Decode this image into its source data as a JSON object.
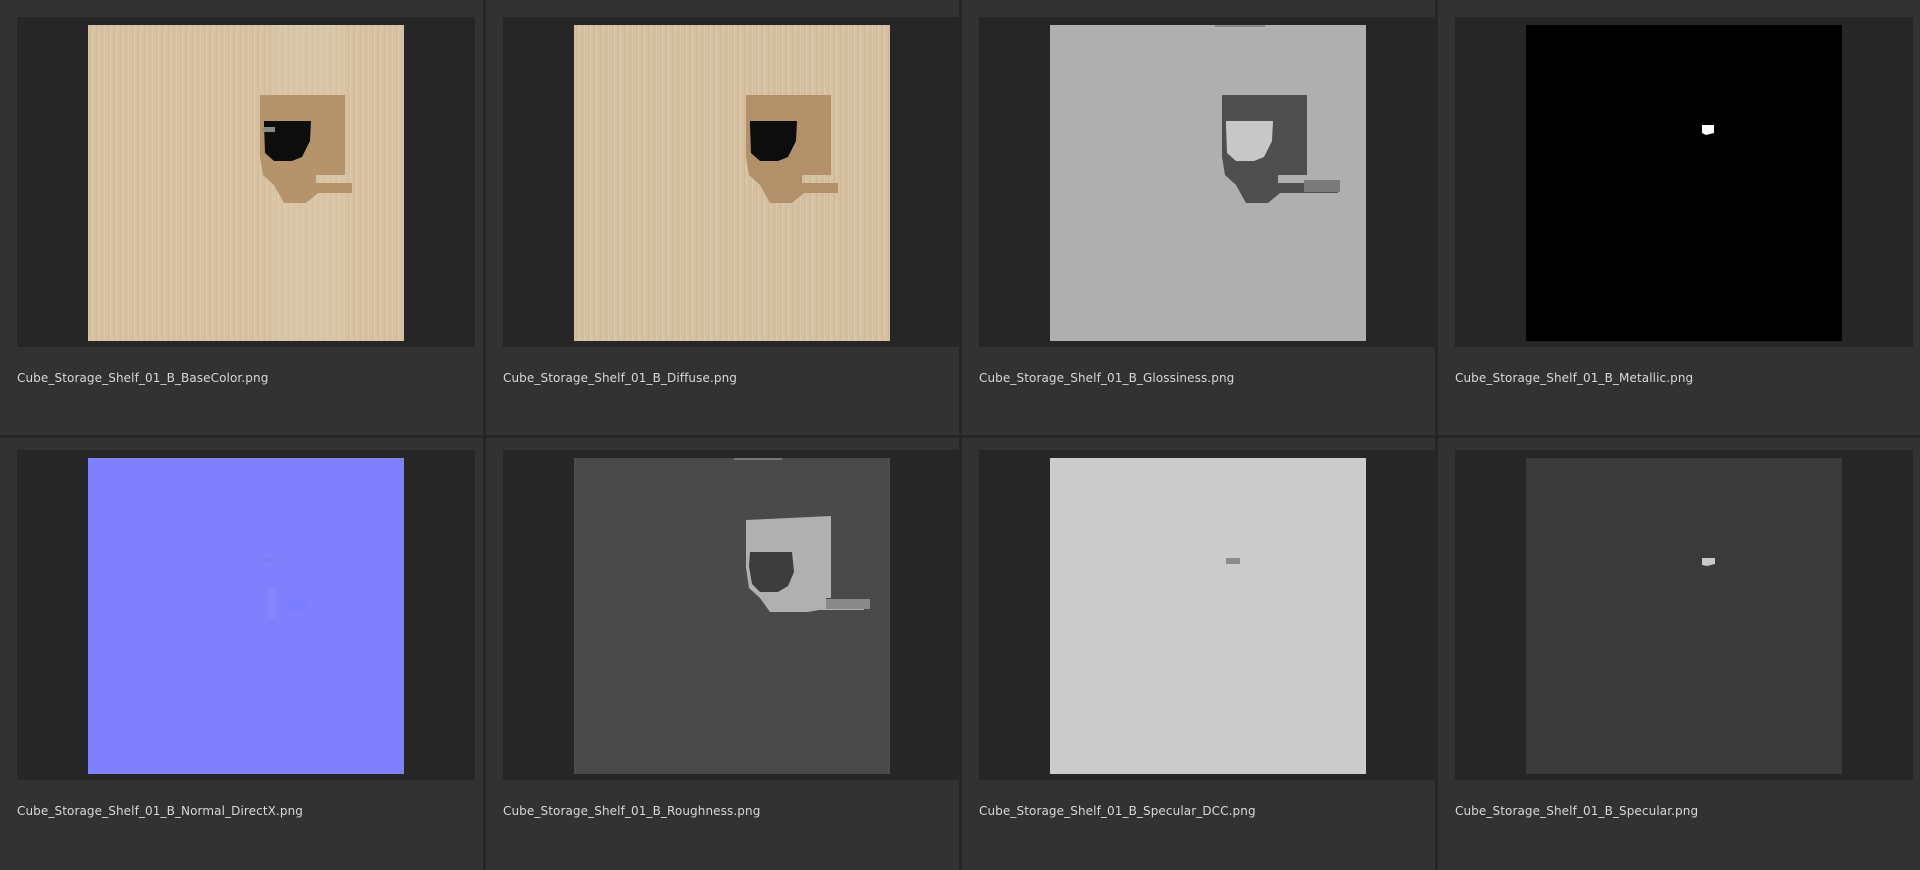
{
  "assets": [
    {
      "filename": "Cube_Storage_Shelf_01_B_BaseColor.png",
      "map": "basecolor",
      "icon": "wood-texture-thumbnail"
    },
    {
      "filename": "Cube_Storage_Shelf_01_B_Diffuse.png",
      "map": "diffuse",
      "icon": "wood-texture-thumbnail"
    },
    {
      "filename": "Cube_Storage_Shelf_01_B_Glossiness.png",
      "map": "glossiness",
      "icon": "grayscale-texture-thumbnail"
    },
    {
      "filename": "Cube_Storage_Shelf_01_B_Metallic.png",
      "map": "metallic",
      "icon": "black-texture-thumbnail"
    },
    {
      "filename": "Cube_Storage_Shelf_01_B_Normal_DirectX.png",
      "map": "normal",
      "icon": "normal-map-thumbnail"
    },
    {
      "filename": "Cube_Storage_Shelf_01_B_Roughness.png",
      "map": "roughness",
      "icon": "grayscale-texture-thumbnail"
    },
    {
      "filename": "Cube_Storage_Shelf_01_B_Specular_DCC.png",
      "map": "specular-dcc",
      "icon": "light-gray-texture-thumbnail"
    },
    {
      "filename": "Cube_Storage_Shelf_01_B_Specular.png",
      "map": "specular",
      "icon": "dark-gray-texture-thumbnail"
    }
  ],
  "colors": {
    "background": "#303030",
    "frame": "#262626",
    "wood": "#d3bfa0",
    "normal": "#8080ff",
    "glossiness": "#afafaf",
    "metallic": "#000000",
    "roughness": "#4a4a4a",
    "specular_dcc": "#cbcbcb",
    "specular": "#3a3a3a"
  }
}
